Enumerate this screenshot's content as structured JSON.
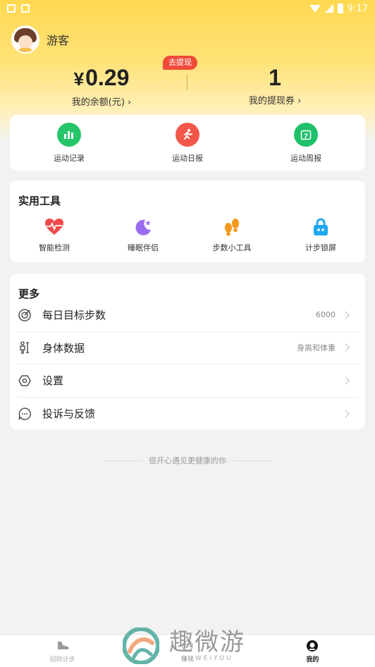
{
  "status_bar": {
    "time": "9:17"
  },
  "user": {
    "name": "游客"
  },
  "withdraw_badge": "去提现",
  "balance": {
    "currency": "¥",
    "value": "0.29",
    "label": "我的余额(元) ›"
  },
  "vouchers": {
    "value": "1",
    "label": "我的提现券 ›"
  },
  "sport_items": [
    {
      "label": "运动记录",
      "icon": "bar-chart-icon",
      "color": "#27c56a"
    },
    {
      "label": "运动日报",
      "icon": "runner-icon",
      "color": "#f2574a"
    },
    {
      "label": "运动周报",
      "icon": "calendar-7-icon",
      "color": "#1fc06a"
    }
  ],
  "tools": {
    "title": "实用工具",
    "items": [
      {
        "label": "智能检测",
        "icon": "heart-pulse-icon",
        "color": "#f14b4b"
      },
      {
        "label": "睡眠伴侣",
        "icon": "moon-icon",
        "color": "#9b6cf0"
      },
      {
        "label": "步数小工具",
        "icon": "footprints-icon",
        "color": "#f39a1e"
      },
      {
        "label": "计步锁屏",
        "icon": "lock-icon",
        "color": "#1fa8f0"
      }
    ]
  },
  "more": {
    "title": "更多",
    "rows": [
      {
        "label": "每日目标步数",
        "value": "6000",
        "icon": "target-icon"
      },
      {
        "label": "身体数据",
        "value": "身高和体重",
        "icon": "body-data-icon"
      },
      {
        "label": "设置",
        "value": "",
        "icon": "settings-icon"
      },
      {
        "label": "投诉与反馈",
        "value": "",
        "icon": "chat-icon"
      }
    ]
  },
  "footer_note": "很开心遇见更健康的你",
  "tabbar": [
    {
      "label": "招财计步",
      "icon": "shoe-icon"
    },
    {
      "label": "赚钱",
      "icon": "coin-icon"
    },
    {
      "label": "我的",
      "icon": "profile-icon",
      "active": true
    }
  ],
  "watermark": {
    "cn": "趣微游",
    "en": "QUWEIYOU"
  }
}
